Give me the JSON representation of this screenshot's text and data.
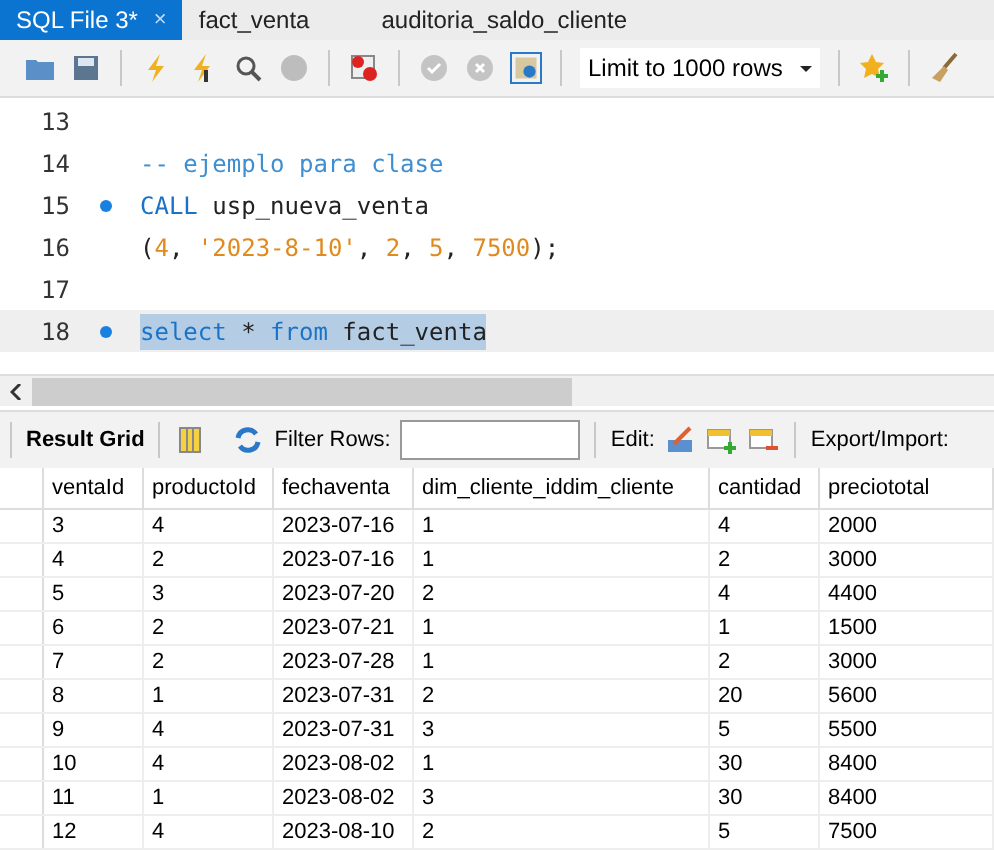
{
  "tabs": [
    {
      "label": "SQL File 3*",
      "selected": true,
      "close_icon": "×"
    },
    {
      "label": "fact_venta",
      "selected": false
    },
    {
      "label": "auditoria_saldo_cliente",
      "selected": false
    }
  ],
  "toolbar": {
    "limit": "Limit to 1000 rows"
  },
  "editor": {
    "lines": [
      {
        "number": "13",
        "marker": false,
        "current": false
      },
      {
        "number": "14",
        "marker": false,
        "current": false,
        "tokens": [
          {
            "kind": "comment",
            "text": "-- ejemplo para clase"
          }
        ]
      },
      {
        "number": "15",
        "marker": true,
        "current": false,
        "tokens": [
          {
            "kind": "keyword",
            "text": "CALL"
          },
          {
            "kind": "plain",
            "text": " usp_nueva_venta"
          }
        ]
      },
      {
        "number": "16",
        "marker": false,
        "current": false,
        "tokens": [
          {
            "kind": "plain",
            "text": "("
          },
          {
            "kind": "number",
            "text": "4"
          },
          {
            "kind": "plain",
            "text": ", "
          },
          {
            "kind": "string",
            "text": "'2023-8-10'"
          },
          {
            "kind": "plain",
            "text": ", "
          },
          {
            "kind": "number",
            "text": "2"
          },
          {
            "kind": "plain",
            "text": ", "
          },
          {
            "kind": "number",
            "text": "5"
          },
          {
            "kind": "plain",
            "text": ", "
          },
          {
            "kind": "number",
            "text": "7500"
          },
          {
            "kind": "plain",
            "text": ");"
          }
        ]
      },
      {
        "number": "17",
        "marker": false,
        "current": false
      },
      {
        "number": "18",
        "marker": true,
        "current": true,
        "tokens": [
          {
            "kind": "keyword",
            "text": "select"
          },
          {
            "kind": "plain",
            "text": " * "
          },
          {
            "kind": "keyword",
            "text": "from"
          },
          {
            "kind": "plain",
            "text": " fact_venta"
          }
        ]
      }
    ]
  },
  "result_toolbar": {
    "result_grid": "Result Grid",
    "filter_label": "Filter Rows:",
    "edit_label": "Edit:",
    "export_label": "Export/Import:"
  },
  "table": {
    "columns": [
      "ventaId",
      "productoId",
      "fechaventa",
      "dim_cliente_iddim_cliente",
      "cantidad",
      "preciototal"
    ],
    "rows": [
      [
        "3",
        "4",
        "2023-07-16",
        "1",
        "4",
        "2000"
      ],
      [
        "4",
        "2",
        "2023-07-16",
        "1",
        "2",
        "3000"
      ],
      [
        "5",
        "3",
        "2023-07-20",
        "2",
        "4",
        "4400"
      ],
      [
        "6",
        "2",
        "2023-07-21",
        "1",
        "1",
        "1500"
      ],
      [
        "7",
        "2",
        "2023-07-28",
        "1",
        "2",
        "3000"
      ],
      [
        "8",
        "1",
        "2023-07-31",
        "2",
        "20",
        "5600"
      ],
      [
        "9",
        "4",
        "2023-07-31",
        "3",
        "5",
        "5500"
      ],
      [
        "10",
        "4",
        "2023-08-02",
        "1",
        "30",
        "8400"
      ],
      [
        "11",
        "1",
        "2023-08-02",
        "3",
        "30",
        "8400"
      ],
      [
        "12",
        "4",
        "2023-08-10",
        "2",
        "5",
        "7500"
      ]
    ]
  }
}
